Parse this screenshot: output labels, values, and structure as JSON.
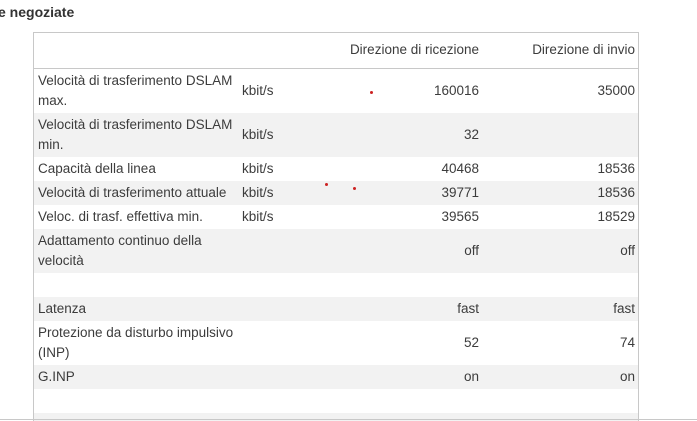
{
  "section": {
    "title": "e negoziate"
  },
  "table": {
    "headers": {
      "label": "",
      "unit": "",
      "rx": "Direzione di ricezione",
      "tx": "Direzione di invio"
    },
    "rows": [
      {
        "label": "Velocità di trasferimento DSLAM max.",
        "unit": "kbit/s",
        "rx": "160016",
        "tx": "35000"
      },
      {
        "label": "Velocità di trasferimento DSLAM min.",
        "unit": "kbit/s",
        "rx": "32",
        "tx": ""
      },
      {
        "label": "Capacità della linea",
        "unit": "kbit/s",
        "rx": "40468",
        "tx": "18536"
      },
      {
        "label": "Velocità di trasferimento attuale",
        "unit": "kbit/s",
        "rx": "39771",
        "tx": "18536"
      },
      {
        "label": "Veloc. di trasf. effettiva min.",
        "unit": "kbit/s",
        "rx": "39565",
        "tx": "18529"
      },
      {
        "label": "Adattamento continuo della velocità",
        "unit": "",
        "rx": "off",
        "tx": "off"
      },
      {
        "label": "",
        "unit": "",
        "rx": "",
        "tx": ""
      },
      {
        "label": "Latenza",
        "unit": "",
        "rx": "fast",
        "tx": "fast"
      },
      {
        "label": "Protezione da disturbo impulsivo (INP)",
        "unit": "",
        "rx": "52",
        "tx": "74"
      },
      {
        "label": "G.INP",
        "unit": "",
        "rx": "on",
        "tx": "on"
      },
      {
        "label": "",
        "unit": "",
        "rx": "",
        "tx": ""
      },
      {
        "label": "",
        "unit": "",
        "rx": "",
        "tx": ""
      }
    ]
  },
  "colors": {
    "border": "#c8c8c8",
    "row_alt": "#f2f2f2",
    "marker": "#cc2222"
  }
}
